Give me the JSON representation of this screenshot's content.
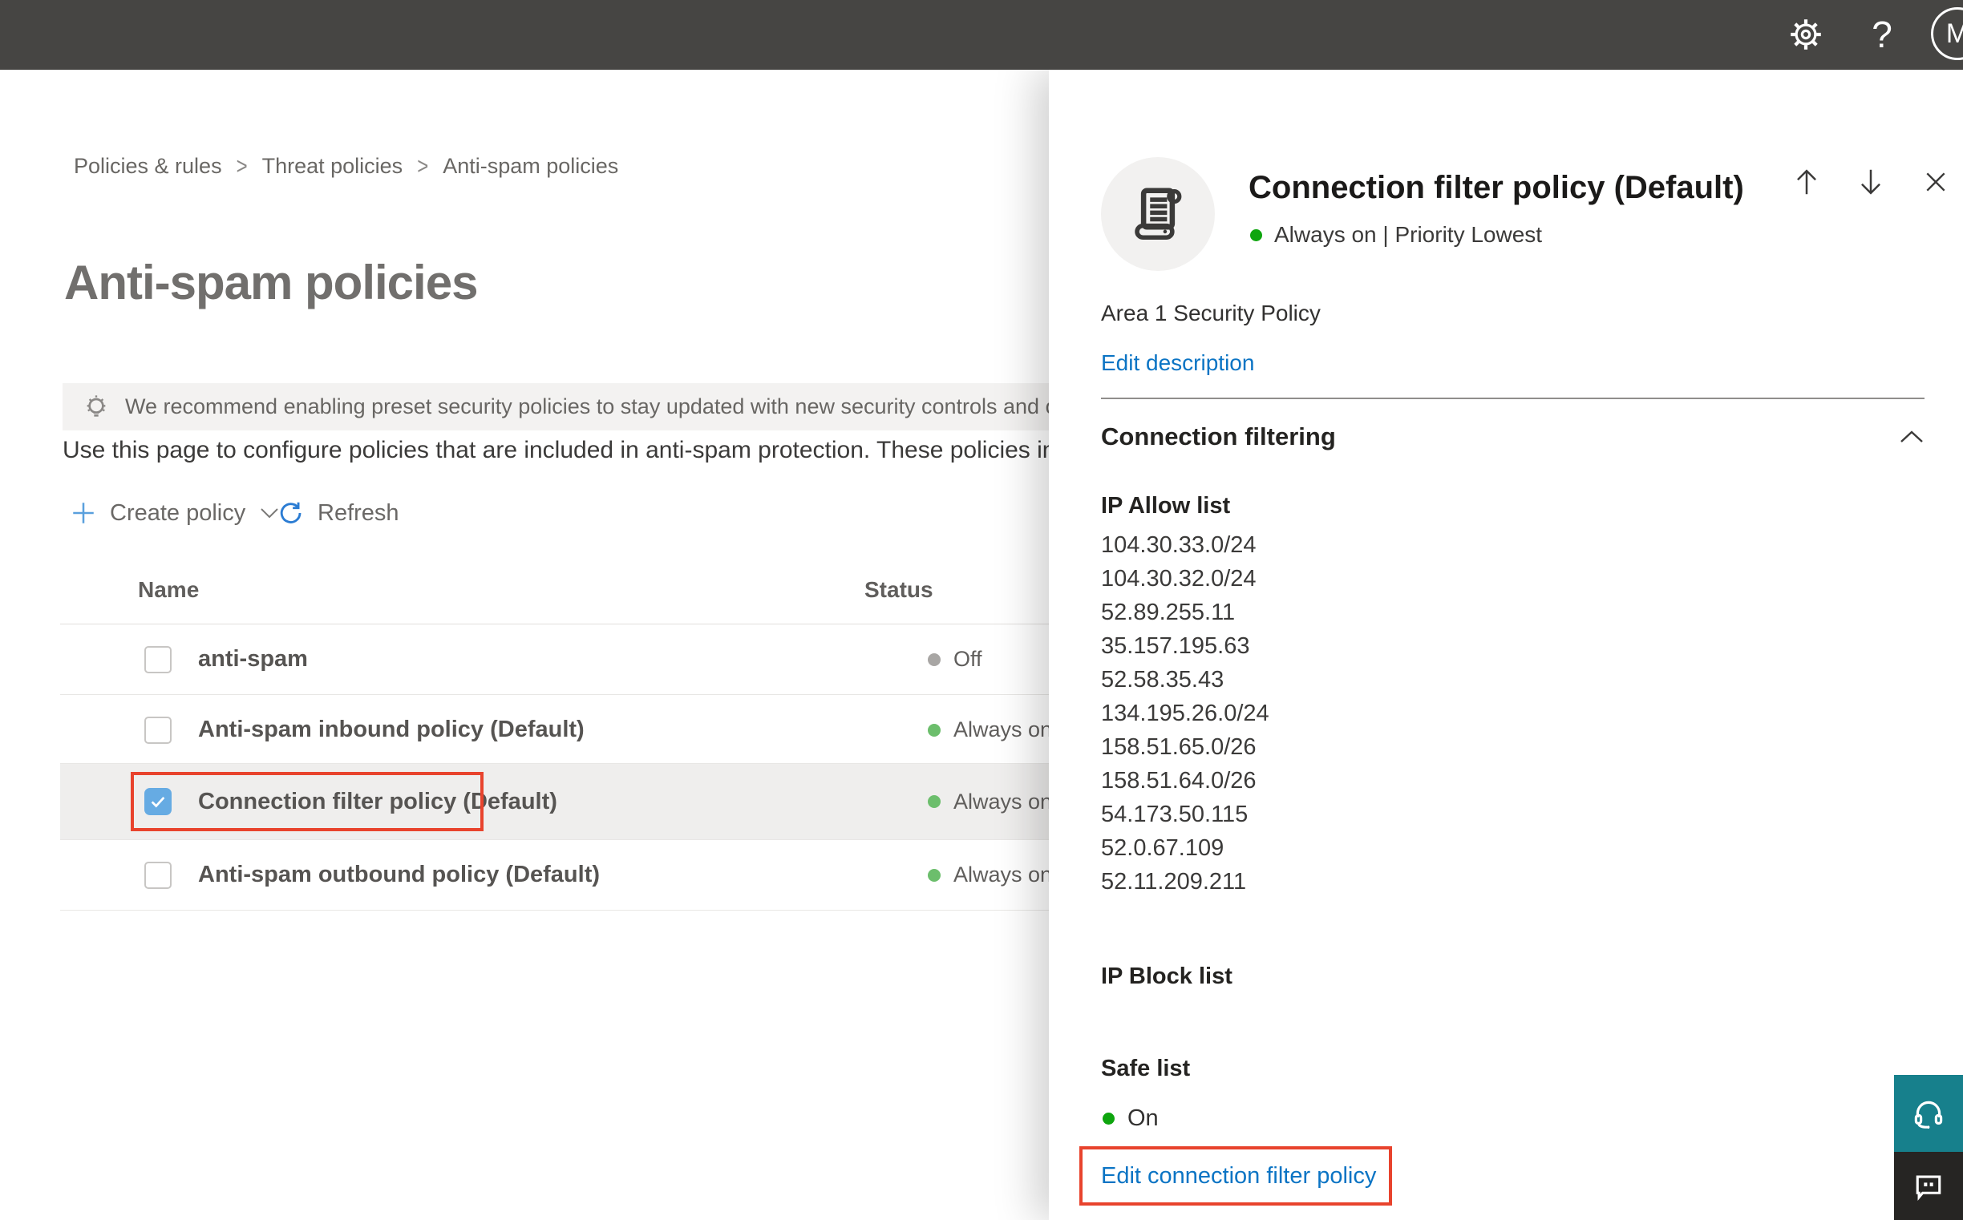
{
  "topbar": {
    "avatar_initial": "M"
  },
  "breadcrumb": {
    "items": [
      "Policies & rules",
      "Threat policies",
      "Anti-spam policies"
    ]
  },
  "page": {
    "title": "Anti-spam policies",
    "banner_text": "We recommend enabling preset security policies to stay updated with new security controls and our recommendations.",
    "description": "Use this page to configure policies that are included in anti-spam protection. These policies include"
  },
  "toolbar": {
    "create_policy_label": "Create policy",
    "refresh_label": "Refresh"
  },
  "table": {
    "columns": [
      "Name",
      "Status"
    ],
    "rows": [
      {
        "name": "anti-spam",
        "status": "Off",
        "status_color": "#a8a6a4",
        "checked": false,
        "selected": false
      },
      {
        "name": "Anti-spam inbound policy (Default)",
        "status": "Always on",
        "status_color": "#6cbe6c",
        "checked": false,
        "selected": false
      },
      {
        "name": "Connection filter policy (Default)",
        "status": "Always on",
        "status_color": "#6cbe6c",
        "checked": true,
        "selected": true
      },
      {
        "name": "Anti-spam outbound policy (Default)",
        "status": "Always on",
        "status_color": "#6cbe6c",
        "checked": false,
        "selected": false
      }
    ]
  },
  "flyout": {
    "title": "Connection filter policy (Default)",
    "status_line": "Always on | Priority Lowest",
    "status_color": "#0ea50e",
    "description": "Area 1 Security Policy",
    "edit_description_label": "Edit description",
    "section_title": "Connection filtering",
    "ip_allow_heading": "IP Allow list",
    "ip_allow": [
      "104.30.33.0/24",
      "104.30.32.0/24",
      "52.89.255.11",
      "35.157.195.63",
      "52.58.35.43",
      "134.195.26.0/24",
      "158.51.65.0/26",
      "158.51.64.0/26",
      "54.173.50.115",
      "52.0.67.109",
      "52.11.209.211"
    ],
    "ip_block_heading": "IP Block list",
    "safe_list_heading": "Safe list",
    "safe_list_status": "On",
    "safe_list_status_color": "#0ea50e",
    "edit_policy_label": "Edit connection filter policy"
  },
  "colors": {
    "accent_blue": "#0b74c4",
    "highlight_red": "#e8432d",
    "support_teal": "#17808c",
    "topbar_dark": "#464543"
  }
}
